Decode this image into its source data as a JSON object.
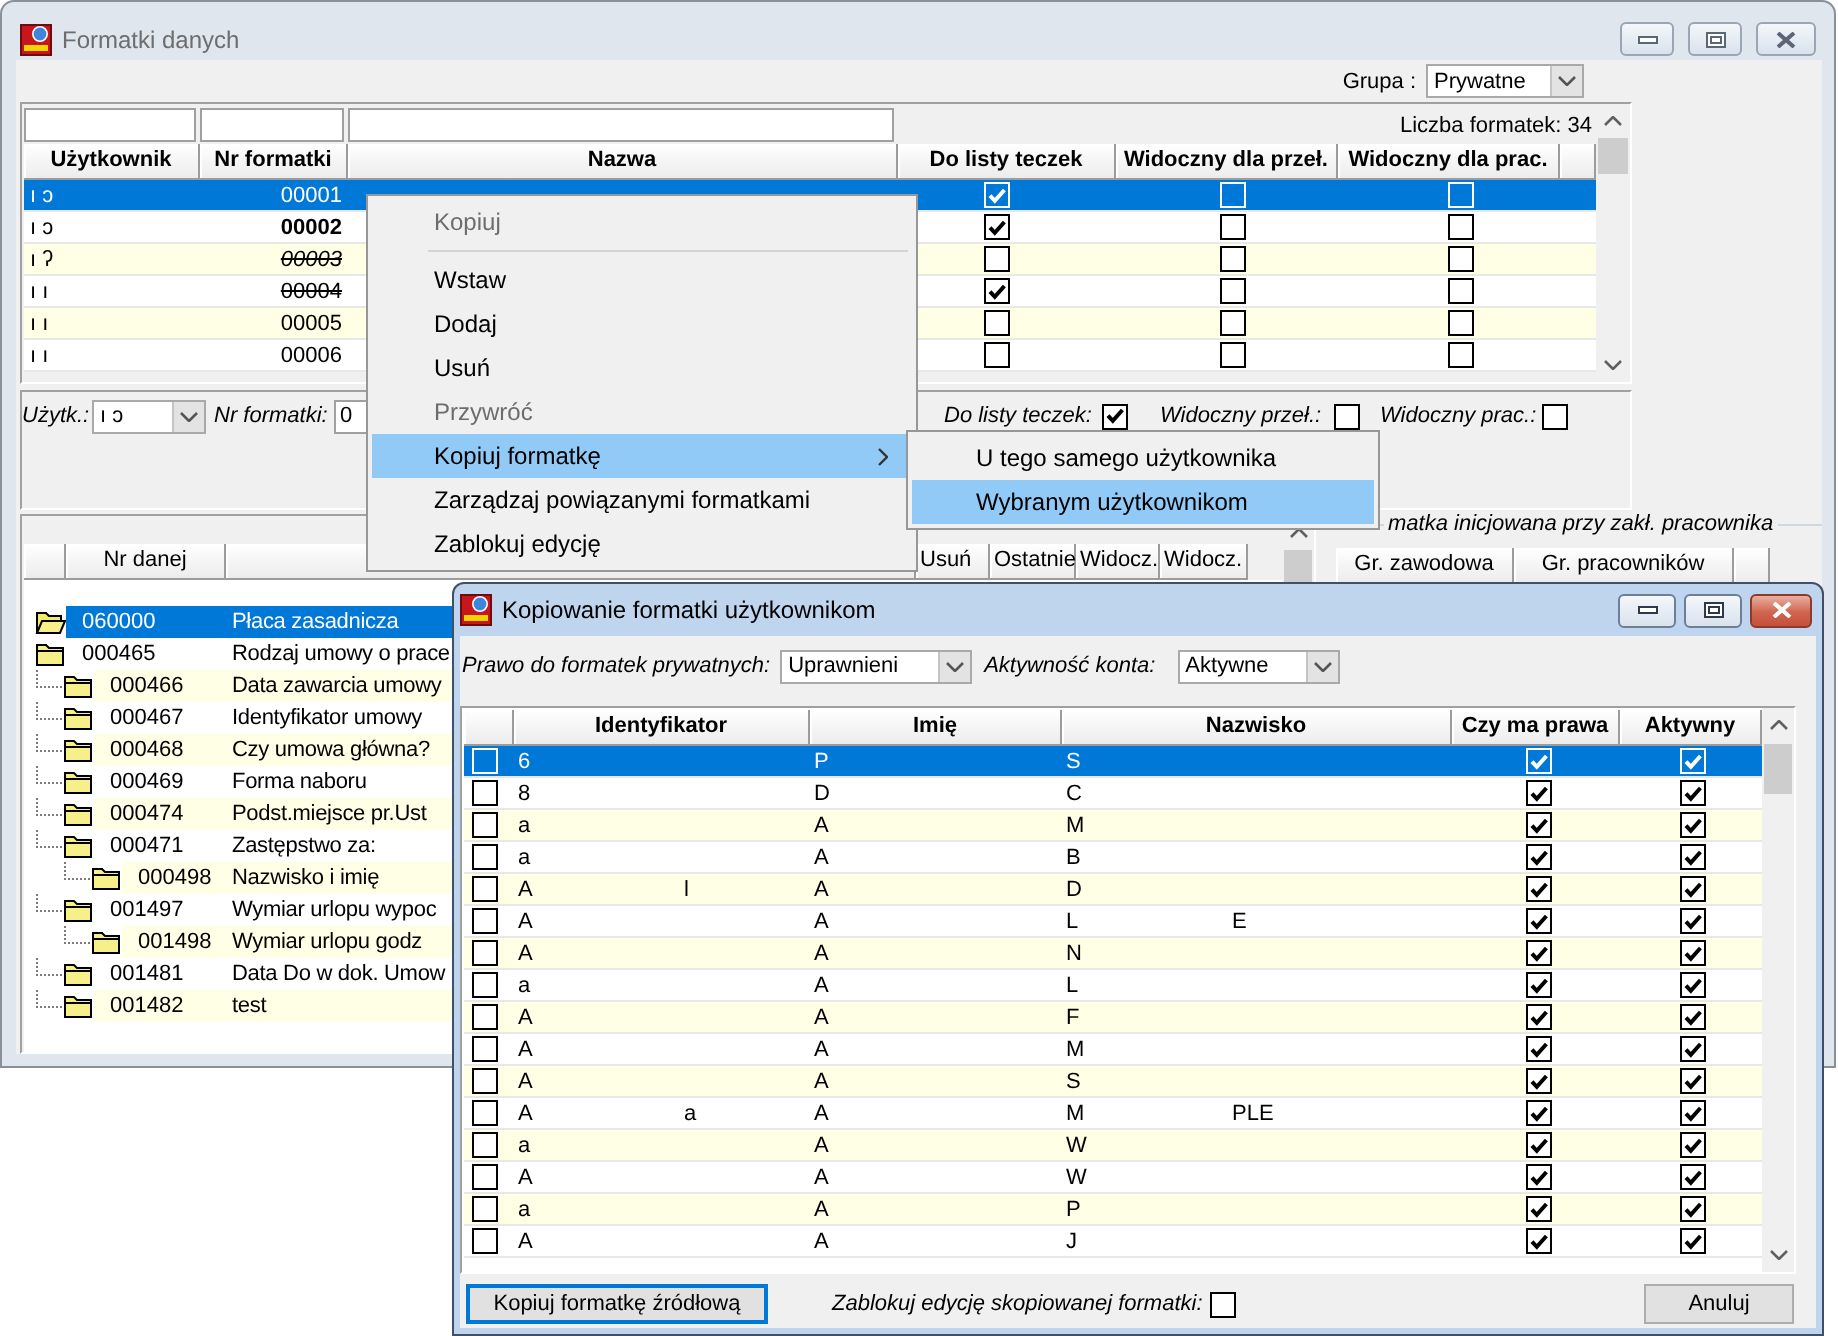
{
  "main_window": {
    "title": "Formatki danych",
    "active": false,
    "group_label": "Grupa :",
    "group_value": "Prywatne"
  },
  "formats_table": {
    "count": "Liczba formatek: 34",
    "columns": [
      "Użytkownik",
      "Nr formatki",
      "Nazwa",
      "Do listy teczek",
      "Widoczny dla przeł.",
      "Widoczny dla prac."
    ],
    "rows": [
      {
        "user": "ı ɔ",
        "number": "00001",
        "bold": false,
        "italic": false,
        "struck": false,
        "to_folder_list": true,
        "visible_for_switch": false,
        "visible_for_employee": false,
        "selected": true
      },
      {
        "user": "ı ɔ",
        "number": "00002",
        "bold": true,
        "italic": false,
        "struck": false,
        "to_folder_list": true,
        "visible_for_switch": false,
        "visible_for_employee": false,
        "selected": false
      },
      {
        "user": "ı ʔ",
        "number": "00003",
        "bold": false,
        "italic": true,
        "struck": true,
        "to_folder_list": false,
        "visible_for_switch": false,
        "visible_for_employee": false,
        "selected": false
      },
      {
        "user": "ı ı",
        "number": "00004",
        "bold": false,
        "italic": false,
        "struck": true,
        "to_folder_list": true,
        "visible_for_switch": false,
        "visible_for_employee": false,
        "selected": false
      },
      {
        "user": "ı ı",
        "number": "00005",
        "bold": false,
        "italic": false,
        "struck": false,
        "to_folder_list": false,
        "visible_for_switch": false,
        "visible_for_employee": false,
        "selected": false
      },
      {
        "user": "ı ı",
        "number": "00006",
        "bold": false,
        "italic": false,
        "struck": false,
        "to_folder_list": false,
        "visible_for_switch": false,
        "visible_for_employee": false,
        "selected": false
      }
    ]
  },
  "details": {
    "user_label": "Użytk.:",
    "user_value": "ı ɔ",
    "number_label": "Nr formatki:",
    "number_value": "0",
    "checks": [
      {
        "label": "Do listy teczek:",
        "checked": true
      },
      {
        "label": "Widoczny przeł.:",
        "checked": false
      },
      {
        "label": "Widoczny prac.:",
        "checked": false
      }
    ]
  },
  "data_table": {
    "columns": [
      "Nr danej",
      "Usuń",
      "Ostatnie",
      "Widocz.",
      "Widocz."
    ],
    "items": [
      {
        "number": "060000",
        "name": "Płaca zasadnicza",
        "selected": true
      },
      {
        "number": "000465",
        "name": "Rodzaj umowy o prace",
        "selected": false,
        "children": [
          {
            "number": "000466",
            "name": "Data zawarcia umowy",
            "selected": false
          },
          {
            "number": "000467",
            "name": "Identyfikator umowy",
            "selected": false
          },
          {
            "number": "000468",
            "name": "Czy umowa główna?",
            "selected": false
          },
          {
            "number": "000469",
            "name": "Forma naboru",
            "selected": false
          },
          {
            "number": "000474",
            "name": "Podst.miejsce pr.Ust",
            "selected": false
          },
          {
            "number": "000471",
            "name": "Zastępstwo za:",
            "selected": false,
            "children": [
              {
                "number": "000498",
                "name": "Nazwisko i imię",
                "selected": false
              }
            ]
          },
          {
            "number": "001497",
            "name": "Wymiar urlopu wypoc",
            "selected": false,
            "children": [
              {
                "number": "001498",
                "name": "Wymiar urlopu godz",
                "selected": false
              }
            ]
          },
          {
            "number": "001481",
            "name": "Data Do w dok. Umow",
            "selected": false
          },
          {
            "number": "001482",
            "name": "test",
            "selected": false
          }
        ]
      }
    ]
  },
  "init_group": {
    "title": "matka inicjowana przy zakł. pracownika",
    "columns": [
      "Gr. zawodowa",
      "Gr. pracowników"
    ]
  },
  "context_menu": {
    "items": [
      {
        "kind": "item",
        "label": "Kopiuj",
        "disabled": true,
        "selected": false
      },
      {
        "kind": "separator"
      },
      {
        "kind": "item",
        "label": "Wstaw",
        "disabled": false,
        "selected": false
      },
      {
        "kind": "item",
        "label": "Dodaj",
        "disabled": false,
        "selected": false
      },
      {
        "kind": "item",
        "label": "Usuń",
        "disabled": false,
        "selected": false
      },
      {
        "kind": "item",
        "label": "Przywróć",
        "disabled": true,
        "selected": false
      },
      {
        "kind": "submenu",
        "label": "Kopiuj formatkę",
        "disabled": false,
        "selected": true
      },
      {
        "kind": "item",
        "label": "Zarządzaj powiązanymi formatkami",
        "disabled": false,
        "selected": false
      },
      {
        "kind": "item",
        "label": "Zablokuj edycję",
        "disabled": false,
        "selected": false
      }
    ]
  },
  "submenu": {
    "items": [
      {
        "label": "U tego samego użytkownika",
        "selected": false
      },
      {
        "label": "Wybranym użytkownikom",
        "selected": true
      }
    ]
  },
  "copy_dialog": {
    "title": "Kopiowanie formatki użytkownikom",
    "active": true,
    "rights_label": "Prawo do formatek prywatnych:",
    "rights_value": "Uprawnieni",
    "activity_label": "Aktywność konta:",
    "activity_value": "Aktywne",
    "columns": [
      "Identyfikator",
      "Imię",
      "Nazwisko",
      "Czy ma prawa",
      "Aktywny"
    ],
    "rows": [
      {
        "checked": false,
        "identifier": "6",
        "first_name": "P",
        "surname": "S",
        "has_rights": true,
        "active": true,
        "selected": true
      },
      {
        "checked": false,
        "identifier": "8",
        "first_name": "D",
        "surname": "C",
        "has_rights": true,
        "active": true,
        "selected": false
      },
      {
        "checked": false,
        "identifier": "a",
        "first_name": "A",
        "surname": "M",
        "has_rights": true,
        "active": true,
        "selected": false
      },
      {
        "checked": false,
        "identifier": "a",
        "first_name": "A",
        "surname": "B",
        "has_rights": true,
        "active": true,
        "selected": false
      },
      {
        "checked": false,
        "identifier": "A",
        "identifier_part2": "l",
        "first_name": "A",
        "surname": "D",
        "has_rights": true,
        "active": true,
        "selected": false
      },
      {
        "checked": false,
        "identifier": "A",
        "first_name": "A",
        "surname": "L",
        "surname_part2": "E",
        "has_rights": true,
        "active": true,
        "selected": false
      },
      {
        "checked": false,
        "identifier": "A",
        "first_name": "A",
        "surname": "N",
        "has_rights": true,
        "active": true,
        "selected": false
      },
      {
        "checked": false,
        "identifier": "a",
        "first_name": "A",
        "surname": "L",
        "has_rights": true,
        "active": true,
        "selected": false
      },
      {
        "checked": false,
        "identifier": "A",
        "first_name": "A",
        "surname": "F",
        "has_rights": true,
        "active": true,
        "selected": false
      },
      {
        "checked": false,
        "identifier": "A",
        "first_name": "A",
        "surname": "M",
        "has_rights": true,
        "active": true,
        "selected": false
      },
      {
        "checked": false,
        "identifier": "A",
        "first_name": "A",
        "surname": "S",
        "has_rights": true,
        "active": true,
        "selected": false
      },
      {
        "checked": false,
        "identifier": "A",
        "identifier_part2": "a",
        "first_name": "A",
        "surname": "M",
        "surname_part2": "PLE",
        "has_rights": true,
        "active": true,
        "selected": false
      },
      {
        "checked": false,
        "identifier": "a",
        "first_name": "A",
        "surname": "W",
        "has_rights": true,
        "active": true,
        "selected": false
      },
      {
        "checked": false,
        "identifier": "A",
        "first_name": "A",
        "surname": "W",
        "has_rights": true,
        "active": true,
        "selected": false
      },
      {
        "checked": false,
        "identifier": "a",
        "first_name": "A",
        "surname": "P",
        "has_rights": true,
        "active": true,
        "selected": false
      },
      {
        "checked": false,
        "identifier": "A",
        "first_name": "A",
        "surname": "J",
        "has_rights": true,
        "active": true,
        "selected": false
      }
    ],
    "copy_button": {
      "label": "Kopiuj formatkę źródłową",
      "focused": true
    },
    "lock": {
      "label": "Zablokuj edycję skopiowanej formatki:",
      "checked": false
    },
    "cancel_button": {
      "label": "Anuluj",
      "focused": false
    }
  }
}
